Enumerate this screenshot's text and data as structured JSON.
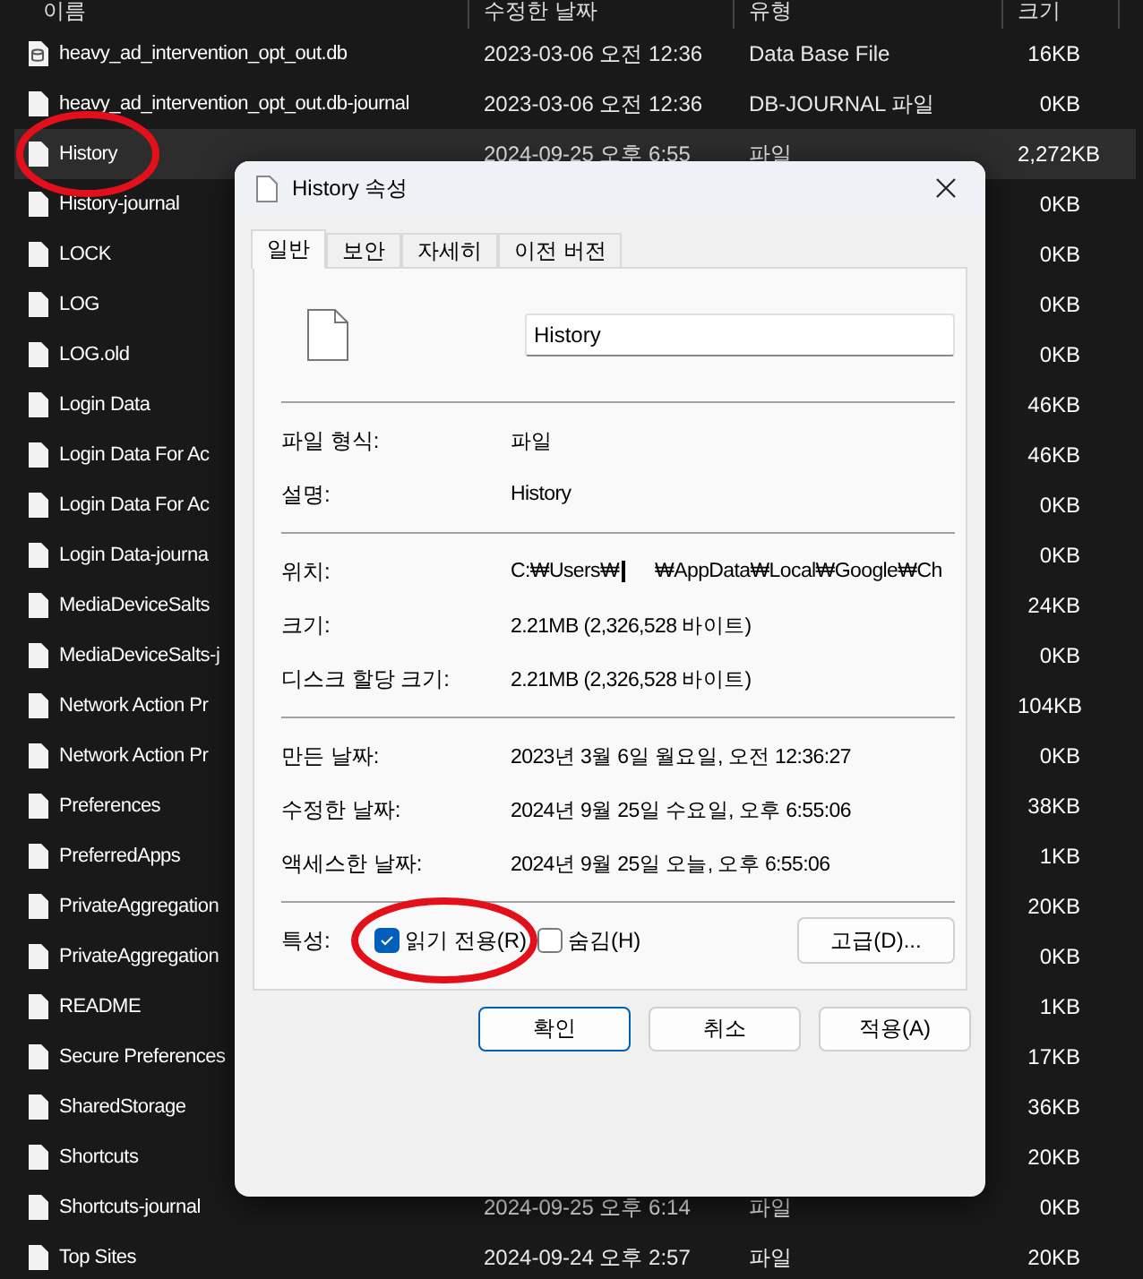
{
  "file_list": {
    "columns": [
      "이름",
      "수정한 날짜",
      "유형",
      "크기"
    ],
    "rows": [
      {
        "name": "heavy_ad_intervention_opt_out.db",
        "modified": "2023-03-06 오전 12:36",
        "type": "Data Base File",
        "size": "16KB",
        "kind": "db",
        "selected": false,
        "circled": false
      },
      {
        "name": "heavy_ad_intervention_opt_out.db-journal",
        "modified": "2023-03-06 오전 12:36",
        "type": "DB-JOURNAL 파일",
        "size": "0KB",
        "kind": "file",
        "selected": false,
        "circled": false
      },
      {
        "name": "History",
        "modified": "2024-09-25 오후 6:55",
        "type": "파일",
        "size": "2,272KB",
        "kind": "file",
        "selected": true,
        "circled": true
      },
      {
        "name": "History-journal",
        "size": "0KB",
        "kind": "file",
        "selected": false,
        "circled": false
      },
      {
        "name": "LOCK",
        "size": "0KB",
        "kind": "file",
        "selected": false,
        "circled": false
      },
      {
        "name": "LOG",
        "size": "0KB",
        "kind": "file",
        "selected": false,
        "circled": false
      },
      {
        "name": "LOG.old",
        "size": "0KB",
        "kind": "file",
        "selected": false,
        "circled": false
      },
      {
        "name": "Login Data",
        "size": "46KB",
        "kind": "file",
        "selected": false,
        "circled": false
      },
      {
        "name": "Login Data For Ac",
        "size": "46KB",
        "kind": "file",
        "selected": false,
        "circled": false
      },
      {
        "name": "Login Data For Ac",
        "size": "0KB",
        "kind": "file",
        "selected": false,
        "circled": false
      },
      {
        "name": "Login Data-journa",
        "size": "0KB",
        "kind": "file",
        "selected": false,
        "circled": false
      },
      {
        "name": "MediaDeviceSalts",
        "size": "24KB",
        "kind": "file",
        "selected": false,
        "circled": false
      },
      {
        "name": "MediaDeviceSalts-j",
        "size": "0KB",
        "kind": "file",
        "selected": false,
        "circled": false
      },
      {
        "name": "Network Action Pr",
        "size": "104KB",
        "kind": "file",
        "selected": false,
        "circled": false
      },
      {
        "name": "Network Action Pr",
        "size": "0KB",
        "kind": "file",
        "selected": false,
        "circled": false
      },
      {
        "name": "Preferences",
        "size": "38KB",
        "kind": "file",
        "selected": false,
        "circled": false
      },
      {
        "name": "PreferredApps",
        "size": "1KB",
        "kind": "file",
        "selected": false,
        "circled": false
      },
      {
        "name": "PrivateAggregation",
        "size": "20KB",
        "kind": "file",
        "selected": false,
        "circled": false
      },
      {
        "name": "PrivateAggregation",
        "size": "0KB",
        "kind": "file",
        "selected": false,
        "circled": false
      },
      {
        "name": "README",
        "size": "1KB",
        "kind": "file",
        "selected": false,
        "circled": false
      },
      {
        "name": "Secure Preferences",
        "size": "17KB",
        "kind": "file",
        "selected": false,
        "circled": false
      },
      {
        "name": "SharedStorage",
        "size": "36KB",
        "kind": "file",
        "selected": false,
        "circled": false
      },
      {
        "name": "Shortcuts",
        "size": "20KB",
        "kind": "file",
        "selected": false,
        "circled": false
      },
      {
        "name": "Shortcuts-journal",
        "modified": "2024-09-25 오후 6:14",
        "type": "파일",
        "size": "0KB",
        "kind": "file",
        "selected": false,
        "circled": false
      },
      {
        "name": "Top Sites",
        "modified": "2024-09-24 오후 2:57",
        "type": "파일",
        "size": "20KB",
        "kind": "file",
        "selected": false,
        "circled": false
      }
    ]
  },
  "dialog": {
    "title": "History 속성",
    "tabs": [
      {
        "label": "일반",
        "selected": true
      },
      {
        "label": "보안",
        "selected": false
      },
      {
        "label": "자세히",
        "selected": false
      },
      {
        "label": "이전 버전",
        "selected": false
      }
    ],
    "file_name": "History",
    "sections": [
      [
        {
          "label": "파일 형식:",
          "parts": [
            "파일"
          ]
        },
        {
          "label": "설명:",
          "parts": [
            "History"
          ]
        }
      ],
      [
        {
          "label": "위치:",
          "parts": [
            "C:₩Users₩",
            "₩AppData₩Local₩Google₩Ch"
          ]
        },
        {
          "label": "크기:",
          "parts": [
            "2.21MB (2,326,528 바이트)"
          ]
        },
        {
          "label": "디스크 할당 크기:",
          "parts": [
            "2.21MB (2,326,528 바이트)"
          ]
        }
      ],
      [
        {
          "label": "만든 날짜:",
          "parts": [
            "2023년 3월 6일 월요일, 오전 12:36:27"
          ]
        },
        {
          "label": "수정한 날짜:",
          "parts": [
            "2024년 9월 25일 수요일, 오후 6:55:06"
          ]
        },
        {
          "label": "액세스한 날짜:",
          "parts": [
            "2024년 9월 25일 오늘, 오후 6:55:06"
          ]
        }
      ]
    ],
    "attributes": {
      "label": "특성:",
      "options": [
        {
          "label": "읽기 전용(R)",
          "checked": true,
          "circled": true
        },
        {
          "label": "숨김(H)",
          "checked": false,
          "circled": false
        }
      ],
      "advanced_button": "고급(D)..."
    },
    "buttons": [
      {
        "label": "확인",
        "default": true
      },
      {
        "label": "취소",
        "default": false
      },
      {
        "label": "적용(A)",
        "default": false
      }
    ]
  }
}
